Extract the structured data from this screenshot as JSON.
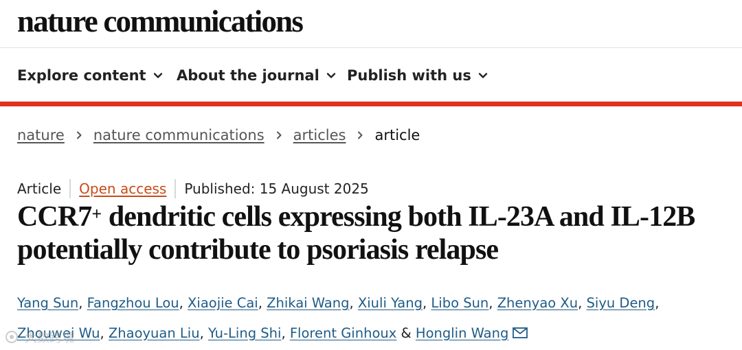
{
  "header": {
    "brand": "nature communications"
  },
  "nav": {
    "items": [
      {
        "label": "Explore content",
        "icon": "chevron-down-icon"
      },
      {
        "label": "About the journal",
        "icon": "chevron-down-icon"
      },
      {
        "label": "Publish with us",
        "icon": "chevron-down-icon"
      }
    ],
    "accent_color": "#e0321c"
  },
  "breadcrumb": {
    "items": [
      "nature",
      "nature communications",
      "articles"
    ],
    "current": "article",
    "separator_icon": "chevron-right-icon"
  },
  "article": {
    "type": "Article",
    "access": "Open access",
    "published": "Published: 15 August 2025",
    "title_prefix": "CCR7",
    "title_sup": "+",
    "title_rest": " dendritic cells expressing both IL-23A and IL-12B potentially contribute to psoriasis relapse",
    "authors": [
      "Yang Sun",
      "Fangzhou Lou",
      "Xiaojie Cai",
      "Zhikai Wang",
      "Xiuli Yang",
      "Libo Sun",
      "Zhenyao Xu",
      "Siyu Deng",
      "Zhouwei Wu",
      "Zhaoyuan Liu",
      "Yu-Ling Shi",
      "Florent Ginhoux"
    ],
    "authors_conjunction": "&",
    "corresponding_author": "Honglin Wang",
    "corresponding_icon": "mail-icon",
    "link_color": "#1e5b86",
    "access_color": "#c74b16"
  },
  "watermark": {
    "text": "大数跨境"
  }
}
